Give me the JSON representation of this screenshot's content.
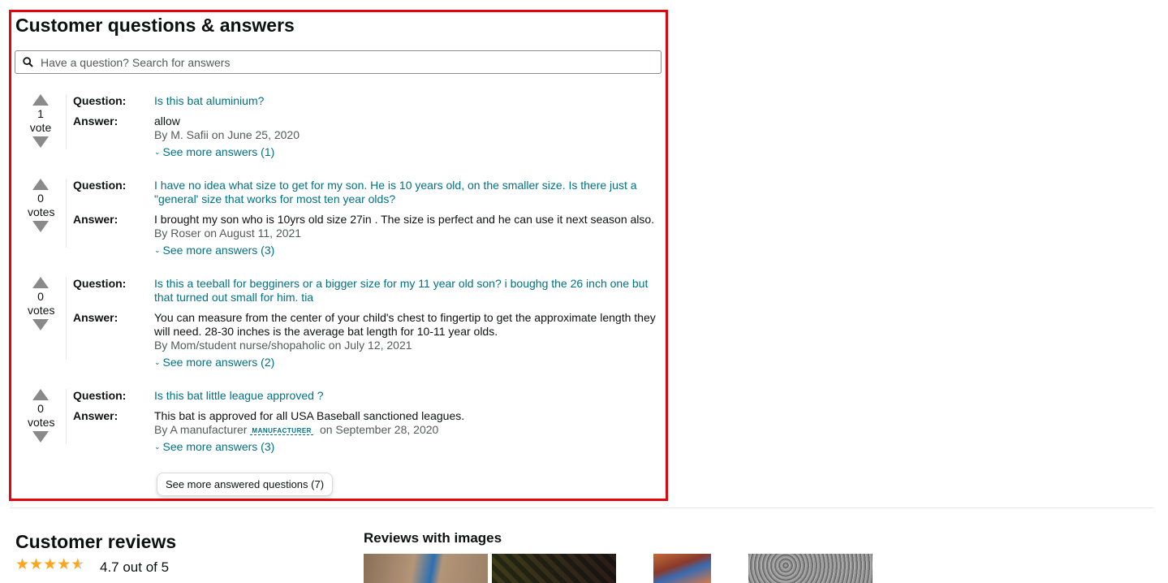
{
  "qa": {
    "title": "Customer questions & answers",
    "search_placeholder": "Have a question? Search for answers",
    "question_label": "Question:",
    "answer_label": "Answer:",
    "items": [
      {
        "votes": "1",
        "votes_label": "vote",
        "question": "Is this bat aluminium?",
        "answer": "allow",
        "byline": "By M. Safii on June 25, 2020",
        "more": "See more answers (1)"
      },
      {
        "votes": "0",
        "votes_label": "votes",
        "question": "I have no idea what size to get for my son. He is 10 years old, on the smaller size. Is there just a \"general' size that works for most ten year olds?",
        "answer": "I brought my son who is 10yrs old size 27in . The size is perfect and he can use it next season also.",
        "byline": "By Roser on August 11, 2021",
        "more": "See more answers (3)"
      },
      {
        "votes": "0",
        "votes_label": "votes",
        "question": "Is this a teeball for begginers or a bigger size for my 11 year old son? i boughg the 26 inch one but that turned out small for him. tia",
        "answer": "You can measure from the center of your child's chest to fingertip to get the approximate length they will need. 28-30 inches is the average bat length for 10-11 year olds.",
        "byline": "By Mom/student nurse/shopaholic on July 12, 2021",
        "more": "See more answers (2)"
      },
      {
        "votes": "0",
        "votes_label": "votes",
        "question": "Is this bat little league approved ?",
        "answer": "This bat is approved for all USA Baseball sanctioned leagues.",
        "byline_prefix": "By A manufacturer",
        "badge": "MANUFACTURER",
        "byline_suffix": "on September 28, 2020",
        "more": "See more answers (3)"
      }
    ],
    "see_more_button": "See more answered questions (7)"
  },
  "reviews": {
    "title": "Customer reviews",
    "rating_text": "4.7 out of 5",
    "rating_value": 4.7,
    "stars_max": 5,
    "images_title": "Reviews with images"
  },
  "colors": {
    "highlight_border": "#e3050e",
    "link": "#007185",
    "star": "#ffa41c"
  }
}
